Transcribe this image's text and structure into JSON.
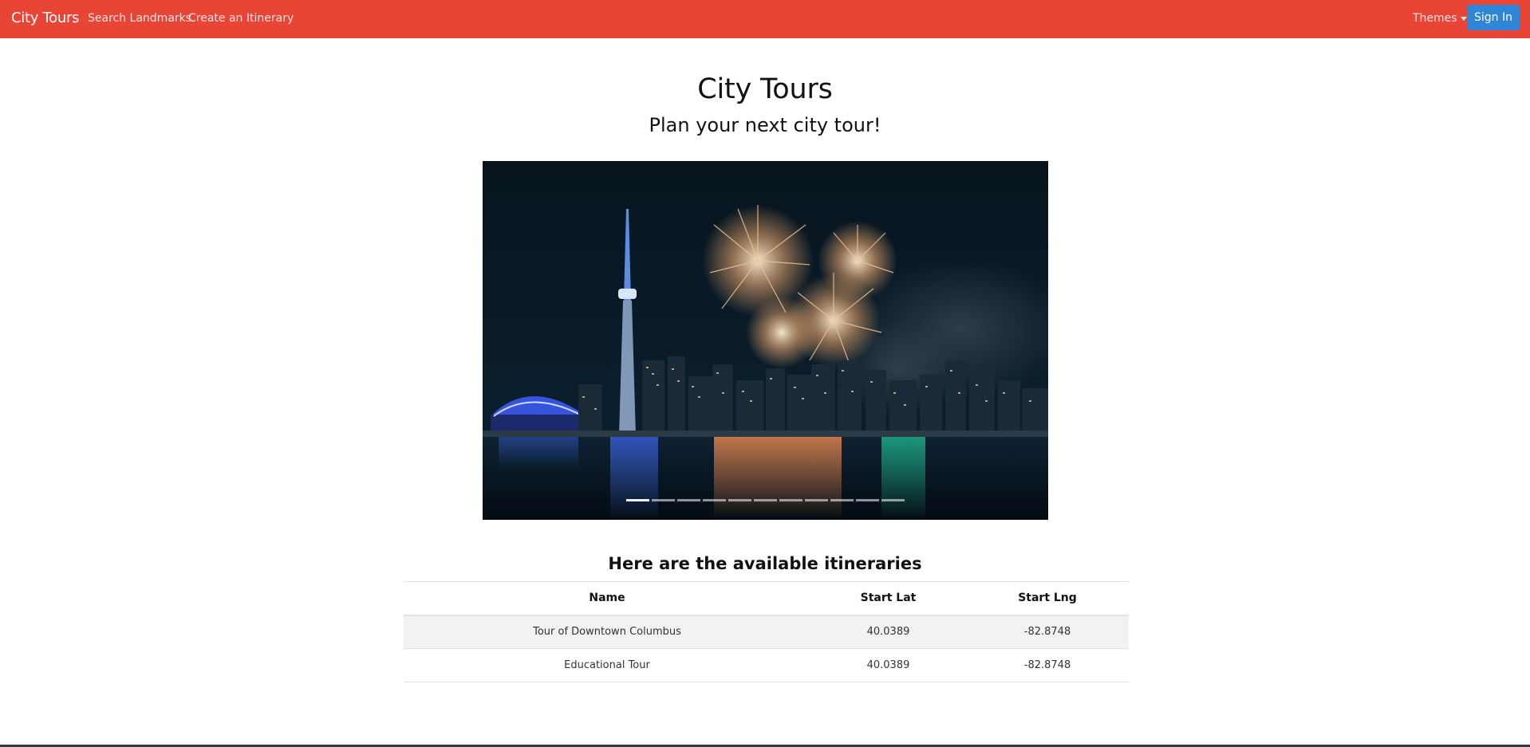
{
  "navbar": {
    "brand": "City Tours",
    "links": [
      "Search Landmarks",
      "Create an Itinerary"
    ],
    "themes_label": "Themes",
    "signin_label": "Sign In",
    "bg_color": "#e84537",
    "signin_color": "#2f86d9"
  },
  "header": {
    "title": "City Tours",
    "subtitle": "Plan your next city tour!"
  },
  "carousel": {
    "image_icon": "city-skyline-fireworks-image",
    "indicator_count": 11,
    "active_index": 0
  },
  "itineraries": {
    "title": "Here are the available itineraries",
    "columns": [
      "Name",
      "Start Lat",
      "Start Lng"
    ],
    "rows": [
      [
        "Tour of Downtown Columbus",
        "40.0389",
        "-82.8748"
      ],
      [
        "Educational Tour",
        "40.0389",
        "-82.8748"
      ]
    ]
  }
}
